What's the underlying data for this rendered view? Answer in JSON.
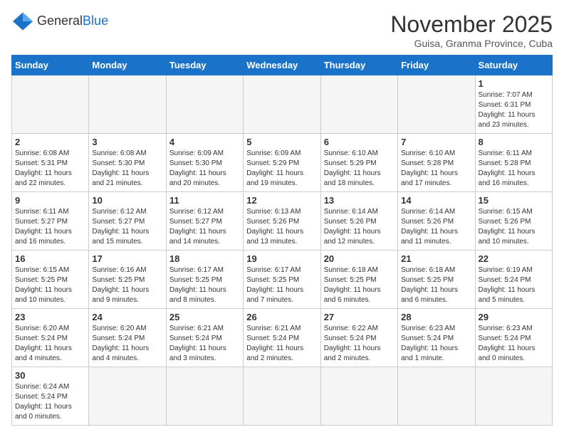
{
  "header": {
    "logo_general": "General",
    "logo_blue": "Blue",
    "month_title": "November 2025",
    "subtitle": "Guisa, Granma Province, Cuba"
  },
  "weekdays": [
    "Sunday",
    "Monday",
    "Tuesday",
    "Wednesday",
    "Thursday",
    "Friday",
    "Saturday"
  ],
  "weeks": [
    [
      {
        "day": null,
        "info": null
      },
      {
        "day": null,
        "info": null
      },
      {
        "day": null,
        "info": null
      },
      {
        "day": null,
        "info": null
      },
      {
        "day": null,
        "info": null
      },
      {
        "day": null,
        "info": null
      },
      {
        "day": "1",
        "info": "Sunrise: 7:07 AM\nSunset: 6:31 PM\nDaylight: 11 hours\nand 23 minutes."
      }
    ],
    [
      {
        "day": "2",
        "info": "Sunrise: 6:08 AM\nSunset: 5:31 PM\nDaylight: 11 hours\nand 22 minutes."
      },
      {
        "day": "3",
        "info": "Sunrise: 6:08 AM\nSunset: 5:30 PM\nDaylight: 11 hours\nand 21 minutes."
      },
      {
        "day": "4",
        "info": "Sunrise: 6:09 AM\nSunset: 5:30 PM\nDaylight: 11 hours\nand 20 minutes."
      },
      {
        "day": "5",
        "info": "Sunrise: 6:09 AM\nSunset: 5:29 PM\nDaylight: 11 hours\nand 19 minutes."
      },
      {
        "day": "6",
        "info": "Sunrise: 6:10 AM\nSunset: 5:29 PM\nDaylight: 11 hours\nand 18 minutes."
      },
      {
        "day": "7",
        "info": "Sunrise: 6:10 AM\nSunset: 5:28 PM\nDaylight: 11 hours\nand 17 minutes."
      },
      {
        "day": "8",
        "info": "Sunrise: 6:11 AM\nSunset: 5:28 PM\nDaylight: 11 hours\nand 16 minutes."
      }
    ],
    [
      {
        "day": "9",
        "info": "Sunrise: 6:11 AM\nSunset: 5:27 PM\nDaylight: 11 hours\nand 16 minutes."
      },
      {
        "day": "10",
        "info": "Sunrise: 6:12 AM\nSunset: 5:27 PM\nDaylight: 11 hours\nand 15 minutes."
      },
      {
        "day": "11",
        "info": "Sunrise: 6:12 AM\nSunset: 5:27 PM\nDaylight: 11 hours\nand 14 minutes."
      },
      {
        "day": "12",
        "info": "Sunrise: 6:13 AM\nSunset: 5:26 PM\nDaylight: 11 hours\nand 13 minutes."
      },
      {
        "day": "13",
        "info": "Sunrise: 6:14 AM\nSunset: 5:26 PM\nDaylight: 11 hours\nand 12 minutes."
      },
      {
        "day": "14",
        "info": "Sunrise: 6:14 AM\nSunset: 5:26 PM\nDaylight: 11 hours\nand 11 minutes."
      },
      {
        "day": "15",
        "info": "Sunrise: 6:15 AM\nSunset: 5:26 PM\nDaylight: 11 hours\nand 10 minutes."
      }
    ],
    [
      {
        "day": "16",
        "info": "Sunrise: 6:15 AM\nSunset: 5:25 PM\nDaylight: 11 hours\nand 10 minutes."
      },
      {
        "day": "17",
        "info": "Sunrise: 6:16 AM\nSunset: 5:25 PM\nDaylight: 11 hours\nand 9 minutes."
      },
      {
        "day": "18",
        "info": "Sunrise: 6:17 AM\nSunset: 5:25 PM\nDaylight: 11 hours\nand 8 minutes."
      },
      {
        "day": "19",
        "info": "Sunrise: 6:17 AM\nSunset: 5:25 PM\nDaylight: 11 hours\nand 7 minutes."
      },
      {
        "day": "20",
        "info": "Sunrise: 6:18 AM\nSunset: 5:25 PM\nDaylight: 11 hours\nand 6 minutes."
      },
      {
        "day": "21",
        "info": "Sunrise: 6:18 AM\nSunset: 5:25 PM\nDaylight: 11 hours\nand 6 minutes."
      },
      {
        "day": "22",
        "info": "Sunrise: 6:19 AM\nSunset: 5:24 PM\nDaylight: 11 hours\nand 5 minutes."
      }
    ],
    [
      {
        "day": "23",
        "info": "Sunrise: 6:20 AM\nSunset: 5:24 PM\nDaylight: 11 hours\nand 4 minutes."
      },
      {
        "day": "24",
        "info": "Sunrise: 6:20 AM\nSunset: 5:24 PM\nDaylight: 11 hours\nand 4 minutes."
      },
      {
        "day": "25",
        "info": "Sunrise: 6:21 AM\nSunset: 5:24 PM\nDaylight: 11 hours\nand 3 minutes."
      },
      {
        "day": "26",
        "info": "Sunrise: 6:21 AM\nSunset: 5:24 PM\nDaylight: 11 hours\nand 2 minutes."
      },
      {
        "day": "27",
        "info": "Sunrise: 6:22 AM\nSunset: 5:24 PM\nDaylight: 11 hours\nand 2 minutes."
      },
      {
        "day": "28",
        "info": "Sunrise: 6:23 AM\nSunset: 5:24 PM\nDaylight: 11 hours\nand 1 minute."
      },
      {
        "day": "29",
        "info": "Sunrise: 6:23 AM\nSunset: 5:24 PM\nDaylight: 11 hours\nand 0 minutes."
      }
    ],
    [
      {
        "day": "30",
        "info": "Sunrise: 6:24 AM\nSunset: 5:24 PM\nDaylight: 11 hours\nand 0 minutes."
      },
      {
        "day": null,
        "info": null
      },
      {
        "day": null,
        "info": null
      },
      {
        "day": null,
        "info": null
      },
      {
        "day": null,
        "info": null
      },
      {
        "day": null,
        "info": null
      },
      {
        "day": null,
        "info": null
      }
    ]
  ]
}
